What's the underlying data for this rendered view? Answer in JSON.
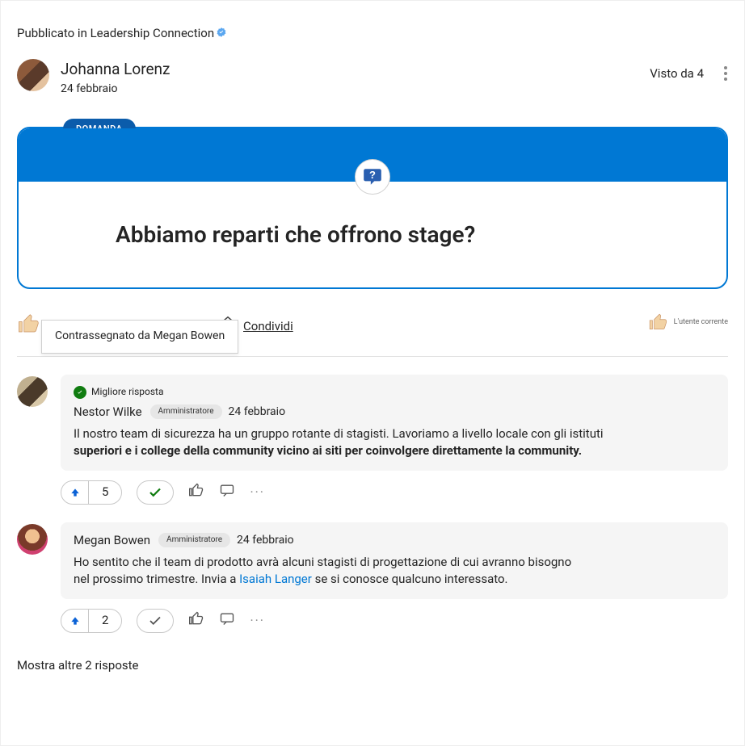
{
  "posted_in_prefix": "Pubblicato in ",
  "posted_in_community": "Leadership Connection",
  "author": {
    "name": "Johanna Lorenz",
    "date": "24 febbraio"
  },
  "seen_by": "Visto da 4",
  "question": {
    "tag": "DOMANDA",
    "text": "Abbiamo reparti che offrono stage?"
  },
  "share_label": "Condividi",
  "tooltip": "Contrassegnato da Megan Bowen",
  "current_user_label": "L'utente corrente",
  "best_answer_label": "Migliore risposta",
  "admin_chip": "Amministratore",
  "comments": [
    {
      "name": "Nestor Wilke",
      "date": "24 febbraio",
      "line1": "Il nostro team di sicurezza ha un gruppo rotante di stagisti. Lavoriamo a livello locale con gli istituti",
      "line2": "superiori e i college della community vicino ai siti per coinvolgere direttamente la community.",
      "votes": "5",
      "best": true,
      "accepted": true
    },
    {
      "name": "Megan Bowen",
      "date": "24 febbraio",
      "line1": "Ho sentito che il team di prodotto avrà alcuni stagisti di progettazione di cui avranno bisogno",
      "line2a": "nel prossimo trimestre. Invia a ",
      "mention": "Isaiah Langer",
      "line2b": " se si conosce qualcuno interessato.",
      "votes": "2",
      "best": false,
      "accepted": false
    }
  ],
  "show_more": "Mostra altre 2 risposte"
}
